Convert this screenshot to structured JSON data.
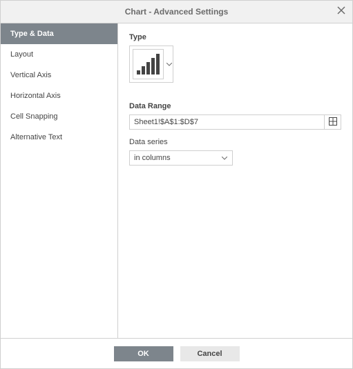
{
  "title": "Chart - Advanced Settings",
  "sidebar": {
    "items": [
      {
        "label": "Type & Data",
        "active": true
      },
      {
        "label": "Layout",
        "active": false
      },
      {
        "label": "Vertical Axis",
        "active": false
      },
      {
        "label": "Horizontal Axis",
        "active": false
      },
      {
        "label": "Cell Snapping",
        "active": false
      },
      {
        "label": "Alternative Text",
        "active": false
      }
    ]
  },
  "content": {
    "type_label": "Type",
    "chart_type_icon": "bar-chart",
    "data_range_label": "Data Range",
    "data_range_value": "Sheet1!$A$1:$D$7",
    "data_series_label": "Data series",
    "data_series_value": "in columns"
  },
  "footer": {
    "ok_label": "OK",
    "cancel_label": "Cancel"
  }
}
